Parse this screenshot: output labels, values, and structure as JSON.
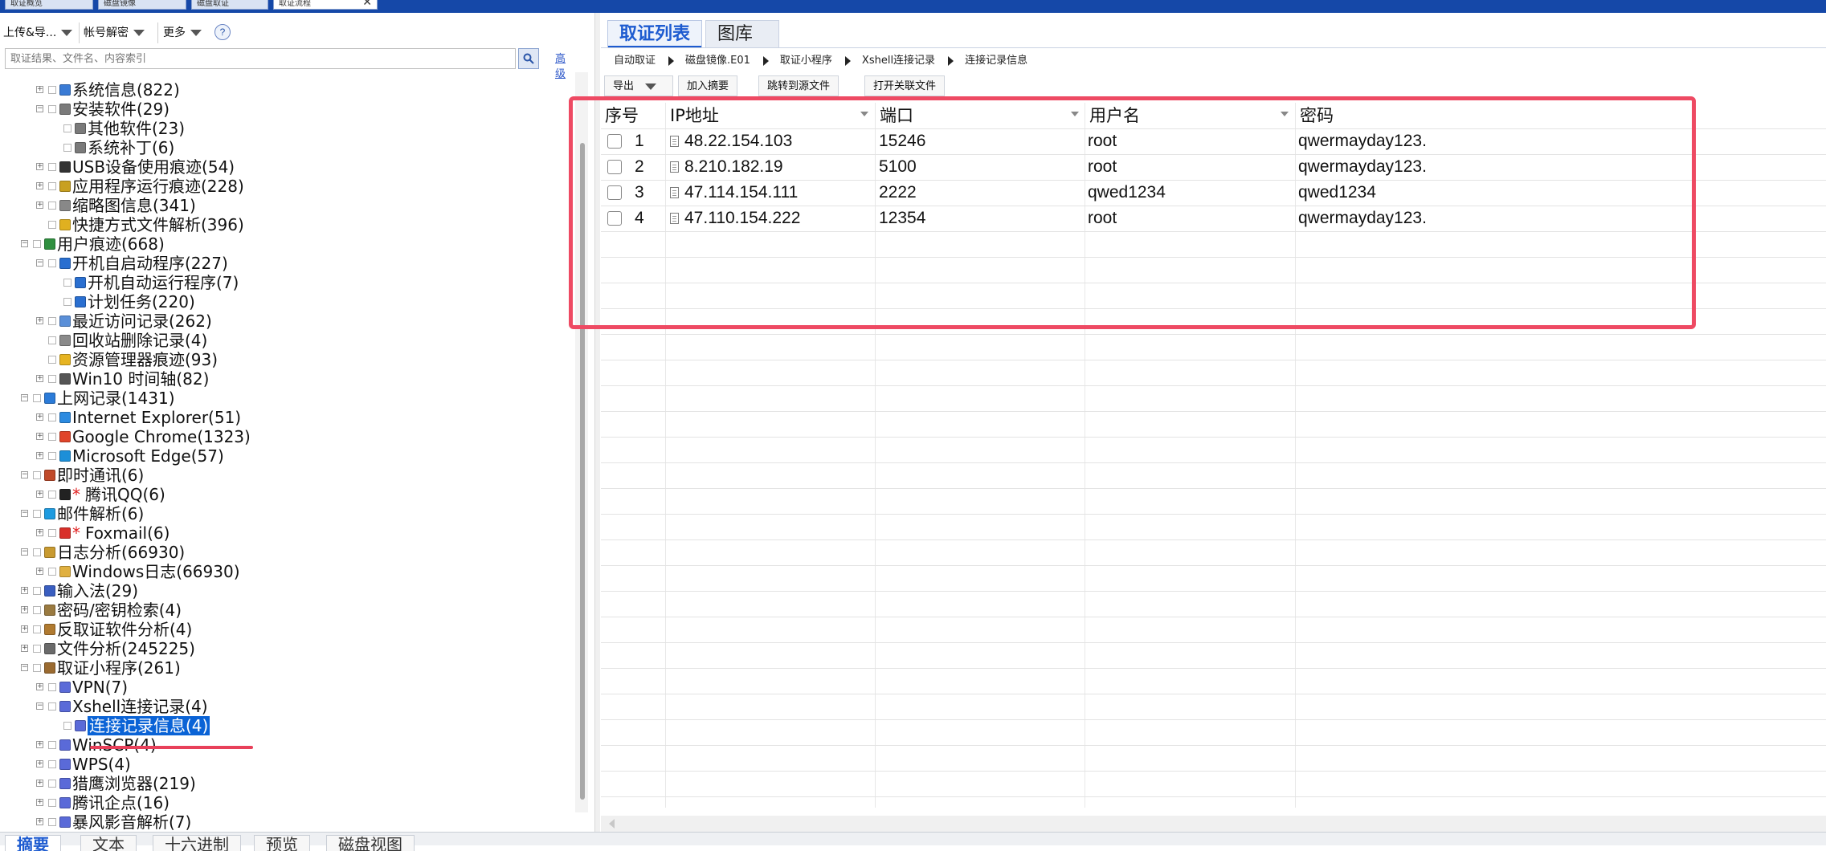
{
  "window": {
    "tabs": [
      {
        "label": "取证概览"
      },
      {
        "label": "磁盘镜像"
      },
      {
        "label": "磁盘取证"
      },
      {
        "label": "取证流程"
      }
    ]
  },
  "left_panel": {
    "menus": {
      "upload": "上传&导...",
      "account": "帐号解密",
      "more": "更多"
    },
    "help_label": "?",
    "search": {
      "placeholder": "取证结果、文件名、内容索引"
    },
    "advanced_label": "高级",
    "tree": [
      {
        "label": "系统信息(822)",
        "icon": "system-info-icon",
        "color": "#3a7bd5"
      },
      {
        "label": "安装软件(29)",
        "icon": "installer-icon",
        "color": "#7a7a7a"
      },
      {
        "label": "其他软件(23)",
        "icon": "installer-icon",
        "color": "#7a7a7a"
      },
      {
        "label": "系统补丁(6)",
        "icon": "installer-icon",
        "color": "#7a7a7a"
      },
      {
        "label": "USB设备使用痕迹(54)",
        "icon": "usb-icon",
        "color": "#333333"
      },
      {
        "label": "应用程序运行痕迹(228)",
        "icon": "app-run-icon",
        "color": "#c8a020"
      },
      {
        "label": "缩略图信息(341)",
        "icon": "thumbnail-icon",
        "color": "#888888"
      },
      {
        "label": "快捷方式文件解析(396)",
        "icon": "shortcut-icon",
        "color": "#e0b020"
      },
      {
        "label": "用户痕迹(668)",
        "icon": "user-trace-icon",
        "color": "#2f8f3f"
      },
      {
        "label": "开机自启动程序(227)",
        "icon": "startup-icon",
        "color": "#2a6fd0"
      },
      {
        "label": "开机自动运行程序(7)",
        "icon": "startup-icon",
        "color": "#2a6fd0"
      },
      {
        "label": "计划任务(220)",
        "icon": "task-icon",
        "color": "#2a6fd0"
      },
      {
        "label": "最近访问记录(262)",
        "icon": "recent-icon",
        "color": "#5a8fd8"
      },
      {
        "label": "回收站删除记录(4)",
        "icon": "recycle-bin-icon",
        "color": "#8a8a8a"
      },
      {
        "label": "资源管理器痕迹(93)",
        "icon": "folder-icon",
        "color": "#e6b422"
      },
      {
        "label": "Win10 时间轴(82)",
        "icon": "timeline-icon",
        "color": "#555555"
      },
      {
        "label": "上网记录(1431)",
        "icon": "globe-icon",
        "color": "#2b7bd8"
      },
      {
        "label": "Internet Explorer(51)",
        "icon": "ie-icon",
        "color": "#2b8ae0"
      },
      {
        "label": "Google Chrome(1323)",
        "icon": "chrome-icon",
        "color": "#e0442a"
      },
      {
        "label": "Microsoft Edge(57)",
        "icon": "edge-icon",
        "color": "#1d8fd8"
      },
      {
        "label": "即时通讯(6)",
        "icon": "chat-icon",
        "color": "#c04a2a"
      },
      {
        "label": "腾讯QQ(6)",
        "icon": "qq-icon",
        "color": "#222222",
        "mark": "*"
      },
      {
        "label": "邮件解析(6)",
        "icon": "mail-icon",
        "color": "#1e9be0"
      },
      {
        "label": "Foxmail(6)",
        "icon": "foxmail-icon",
        "color": "#d8302a",
        "mark": "*"
      },
      {
        "label": "日志分析(66930)",
        "icon": "log-icon",
        "color": "#c89a30"
      },
      {
        "label": "Windows日志(66930)",
        "icon": "windows-log-icon",
        "color": "#e0b040"
      },
      {
        "label": "输入法(29)",
        "icon": "input-method-icon",
        "color": "#3a5ec0"
      },
      {
        "label": "密码/密钥检索(4)",
        "icon": "key-icon",
        "color": "#9a7a40"
      },
      {
        "label": "反取证软件分析(4)",
        "icon": "anti-forensics-icon",
        "color": "#b07a30"
      },
      {
        "label": "文件分析(245225)",
        "icon": "file-analysis-icon",
        "color": "#6a6a6a"
      },
      {
        "label": "取证小程序(261)",
        "icon": "applet-icon",
        "color": "#9a6a30"
      },
      {
        "label": "VPN(7)",
        "icon": "applet-icon",
        "color": "#5a6ad8"
      },
      {
        "label": "Xshell连接记录(4)",
        "icon": "applet-icon",
        "color": "#5a6ad8"
      },
      {
        "label": "连接记录信息(4)",
        "icon": "applet-icon",
        "color": "#5a6ad8"
      },
      {
        "label": "WinSCP(4)",
        "icon": "applet-icon",
        "color": "#5a6ad8"
      },
      {
        "label": "WPS(4)",
        "icon": "applet-icon",
        "color": "#5a6ad8"
      },
      {
        "label": "猎鹰浏览器(219)",
        "icon": "applet-icon",
        "color": "#5a6ad8"
      },
      {
        "label": "腾讯企点(16)",
        "icon": "applet-icon",
        "color": "#5a6ad8"
      },
      {
        "label": "暴风影音解析(7)",
        "icon": "applet-icon",
        "color": "#5a6ad8"
      }
    ]
  },
  "right_panel": {
    "tabs": {
      "evidence": "取证列表",
      "gallery": "图库"
    },
    "breadcrumb": [
      "自动取证",
      "磁盘镜像.E01",
      "取证小程序",
      "Xshell连接记录",
      "连接记录信息"
    ],
    "toolbar": {
      "export": "导出",
      "add_summary": "加入摘要",
      "jump_source": "跳转到源文件",
      "open_related": "打开关联文件"
    },
    "table": {
      "columns": [
        "序号",
        "IP地址",
        "端口",
        "用户名",
        "密码"
      ],
      "rows": [
        {
          "no": "1",
          "ip": "48.22.154.103",
          "port": "15246",
          "user": "root",
          "password": "qwermayday123."
        },
        {
          "no": "2",
          "ip": "8.210.182.19",
          "port": "5100",
          "user": "root",
          "password": "qwermayday123."
        },
        {
          "no": "3",
          "ip": "47.114.154.111",
          "port": "2222",
          "user": "qwed1234",
          "password": "qwed1234"
        },
        {
          "no": "4",
          "ip": "47.110.154.222",
          "port": "12354",
          "user": "root",
          "password": "qwermayday123."
        }
      ]
    }
  },
  "bottom_tabs": [
    "摘要",
    "文本",
    "十六进制",
    "预览",
    "磁盘视图"
  ],
  "colors": {
    "accent": "#1d5bd0",
    "highlight_box": "#ee4a63",
    "selection": "#0a63d6",
    "titlebar": "#1548a8"
  }
}
